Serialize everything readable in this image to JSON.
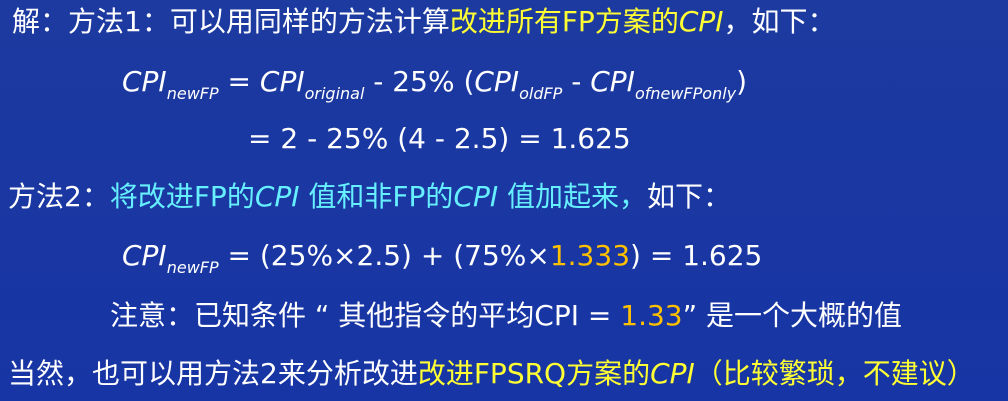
{
  "colors": {
    "background": "#1a37a2",
    "text": "#ffffff",
    "highlight_yellow": "#ffff33",
    "highlight_cyan": "#66f0ff",
    "highlight_orange": "#ffc000"
  },
  "line1": {
    "prefix": "解：方法1：可以用同样的方法计算",
    "highlight": "改进所有FP方案的",
    "cpi": "CPI",
    "suffix": "，如下："
  },
  "line2": {
    "cpi1": "CPI",
    "sub1": "newFP",
    "eq": " = ",
    "cpi2": "CPI",
    "sub2": "original",
    "mid": " -  25% (",
    "cpi3": "CPI",
    "sub3": "oldFP",
    "minus": " - ",
    "cpi4": "CPI",
    "sub4": "ofnewFPonly",
    "close": ")"
  },
  "line3": {
    "text": "= 2 - 25% (4 - 2.5) = 1.625"
  },
  "line4": {
    "prefix": "方法2：",
    "hl1": "将改进FP的",
    "cpi1": "CPI",
    "hl2": " 值和非FP的",
    "cpi2": "CPI",
    "hl3": " 值加起来，",
    "suffix": "如下："
  },
  "line5": {
    "cpi": "CPI",
    "sub": "newFP",
    "mid": " = (25%×2.5) + (75%×",
    "orange": "1.333",
    "end": ") =  1.625"
  },
  "line6": {
    "prefix": "注意：已知条件 “ 其他指令的平均CPI = ",
    "orange": "1.33",
    "suffix": "” 是一个大概的值"
  },
  "line7": {
    "prefix": "当然，也可以用方法2来分析改进",
    "highlight": "改进FPSRQ方案的",
    "cpi": "CPI",
    "suffix": "（比较繁琐，不建议）"
  }
}
